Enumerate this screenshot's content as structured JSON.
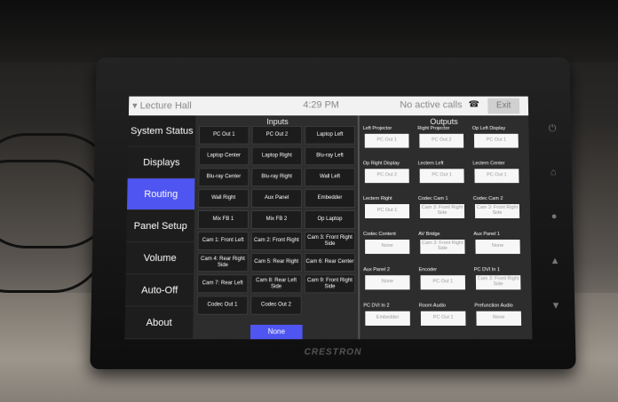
{
  "header": {
    "room": "▾ Lecture Hall",
    "time": "4:29 PM",
    "call_status": "No active calls",
    "exit_label": "Exit"
  },
  "nav": [
    {
      "label": "System Status",
      "active": false
    },
    {
      "label": "Displays",
      "active": false
    },
    {
      "label": "Routing",
      "active": true
    },
    {
      "label": "Panel Setup",
      "active": false
    },
    {
      "label": "Volume",
      "active": false
    },
    {
      "label": "Auto-Off",
      "active": false
    },
    {
      "label": "About",
      "active": false
    }
  ],
  "inputs": {
    "title": "Inputs",
    "items": [
      "PC Out 1",
      "PC Out 2",
      "Laptop Left",
      "Laptop Center",
      "Laptop Right",
      "Blu-ray Left",
      "Blu-ray Center",
      "Blu-ray Right",
      "Wall Left",
      "Wall Right",
      "Aux Panel",
      "Embedder",
      "Mix FB 1",
      "Mix FB 2",
      "Op Laptop",
      "Cam 1: Front Left",
      "Cam 2: Front Right",
      "Cam 3: Front Right Side",
      "Cam 4: Rear Right Side",
      "Cam 5: Rear Right",
      "Cam 6: Rear Center",
      "Cam 7: Rear Left",
      "Cam 8: Rear Left Side",
      "Cam 9: Front Right Side",
      "Codec Out 1",
      "Codec Out 2"
    ],
    "none_label": "None"
  },
  "outputs": {
    "title": "Outputs",
    "items": [
      {
        "label": "Left Projector",
        "value": "PC Out 1"
      },
      {
        "label": "Right Projector",
        "value": "PC Out 2"
      },
      {
        "label": "Op Left Display",
        "value": "PC Out 1"
      },
      {
        "label": "Op Right Display",
        "value": "PC Out 2"
      },
      {
        "label": "Lectern Left",
        "value": "PC Out 1"
      },
      {
        "label": "Lectern Center",
        "value": "PC Out 1"
      },
      {
        "label": "Lectern Right",
        "value": "PC Out 1"
      },
      {
        "label": "Codec Cam 1",
        "value": "Cam 3: Front Right Side"
      },
      {
        "label": "Codec Cam 2",
        "value": "Cam 3: Front Right Side"
      },
      {
        "label": "Codec Content",
        "value": "None"
      },
      {
        "label": "AV Bridge",
        "value": "Cam 3: Front Right Side"
      },
      {
        "label": "Aux Panel 1",
        "value": "None"
      },
      {
        "label": "Aux Panel 2",
        "value": "None"
      },
      {
        "label": "Encoder",
        "value": "PC Out 1"
      },
      {
        "label": "PC DVI In 1",
        "value": "Cam 3: Front Right Side"
      },
      {
        "label": "PC DVI In 2",
        "value": "Embedder"
      },
      {
        "label": "Room Audio",
        "value": "PC Out 1"
      },
      {
        "label": "Prefunction Audio",
        "value": "None"
      }
    ]
  },
  "device": {
    "brand": "CRESTRON",
    "buttons": [
      "power-icon",
      "home-icon",
      "light-icon",
      "up-icon",
      "down-icon"
    ]
  },
  "colors": {
    "accent": "#4f55f0"
  }
}
